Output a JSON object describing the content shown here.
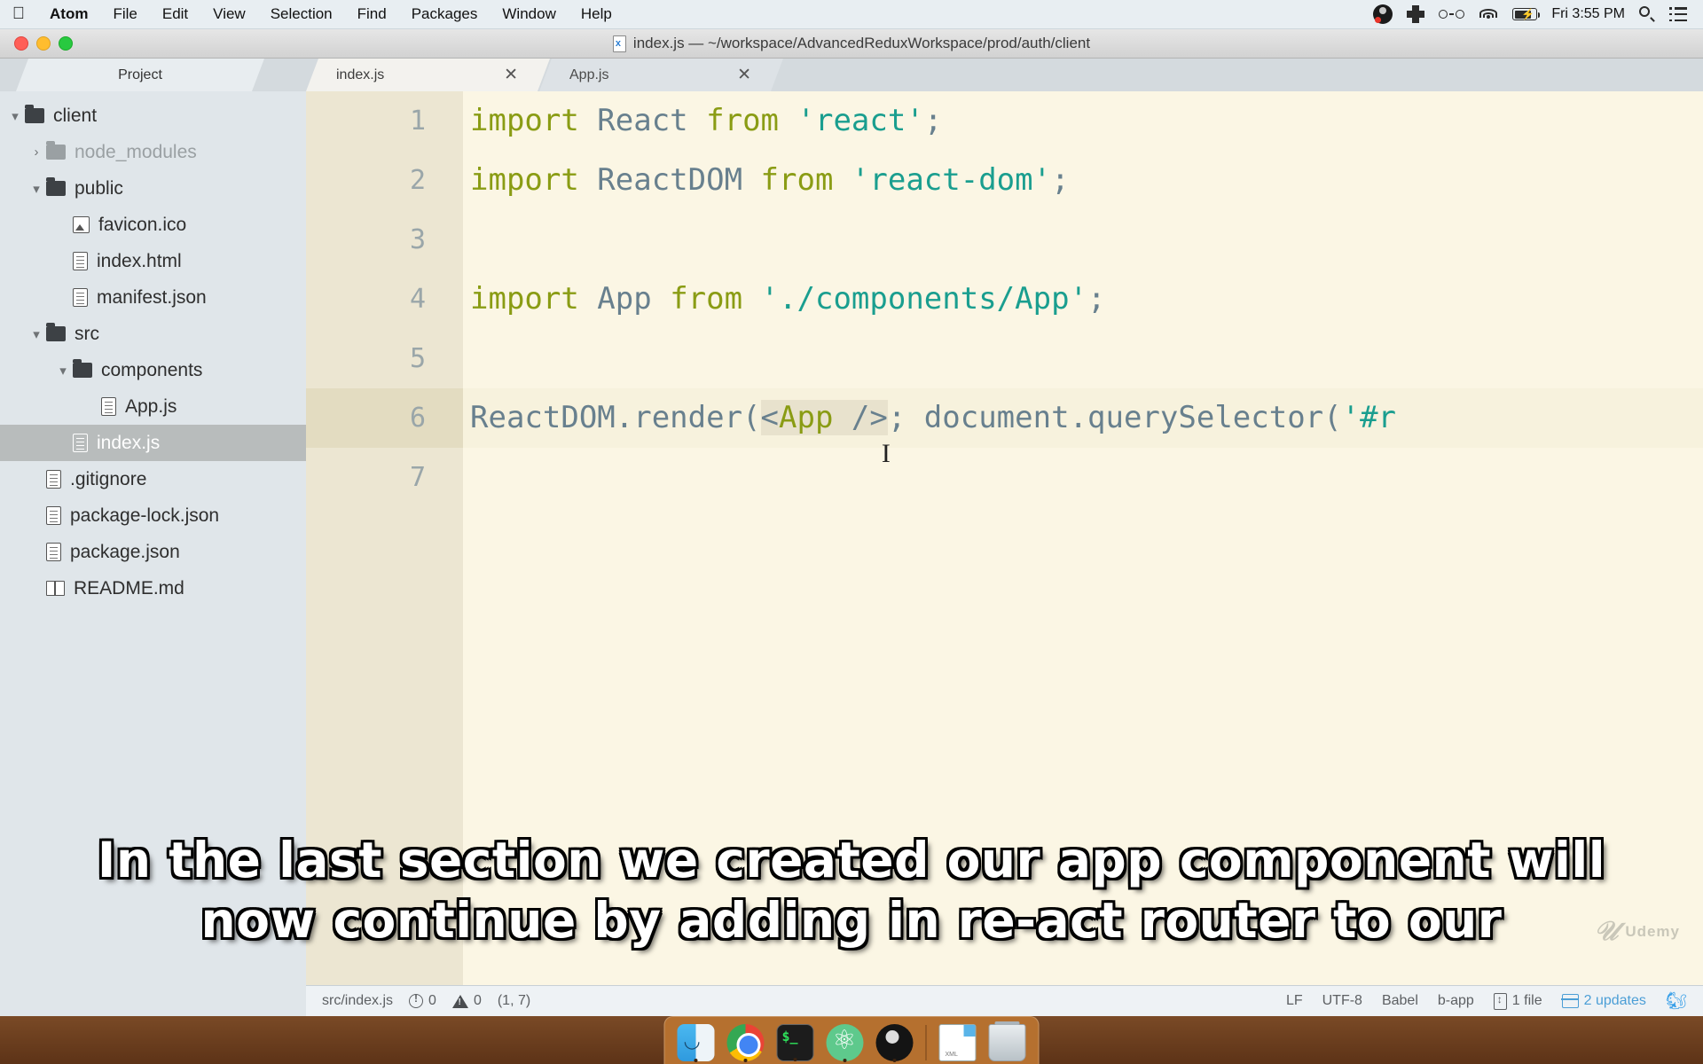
{
  "menubar": {
    "apple_icon": "apple-logo",
    "items": [
      "Atom",
      "File",
      "Edit",
      "View",
      "Selection",
      "Find",
      "Packages",
      "Window",
      "Help"
    ],
    "status_icons": [
      "obs-icon",
      "cross-icon",
      "glasses-icon",
      "wifi-icon",
      "battery-icon"
    ],
    "clock": "Fri 3:55 PM",
    "search_icon": "search-icon",
    "control_center_icon": "list-icon"
  },
  "window": {
    "title": "index.js — ~/workspace/AdvancedReduxWorkspace/prod/auth/client",
    "title_icon": "js-file-icon",
    "traffic_lights": [
      "close-button",
      "minimize-button",
      "zoom-button"
    ]
  },
  "treeview": {
    "tab_label": "Project",
    "items": [
      {
        "label": "client",
        "type": "folder",
        "indent": 0,
        "twisty": "▾",
        "selected": false,
        "muted": false
      },
      {
        "label": "node_modules",
        "type": "folder",
        "indent": 1,
        "twisty": "›",
        "selected": false,
        "muted": true
      },
      {
        "label": "public",
        "type": "folder",
        "indent": 1,
        "twisty": "▾",
        "selected": false,
        "muted": false
      },
      {
        "label": "favicon.ico",
        "type": "image",
        "indent": 2,
        "twisty": "",
        "selected": false,
        "muted": false
      },
      {
        "label": "index.html",
        "type": "file",
        "indent": 2,
        "twisty": "",
        "selected": false,
        "muted": false
      },
      {
        "label": "manifest.json",
        "type": "file",
        "indent": 2,
        "twisty": "",
        "selected": false,
        "muted": false
      },
      {
        "label": "src",
        "type": "folder",
        "indent": 1,
        "twisty": "▾",
        "selected": false,
        "muted": false
      },
      {
        "label": "components",
        "type": "folder",
        "indent": 2,
        "twisty": "▾",
        "selected": false,
        "muted": false
      },
      {
        "label": "App.js",
        "type": "file",
        "indent": 3,
        "twisty": "",
        "selected": false,
        "muted": false
      },
      {
        "label": "index.js",
        "type": "file",
        "indent": 2,
        "twisty": "",
        "selected": true,
        "muted": false
      },
      {
        "label": ".gitignore",
        "type": "file",
        "indent": 1,
        "twisty": "",
        "selected": false,
        "muted": false
      },
      {
        "label": "package-lock.json",
        "type": "file",
        "indent": 1,
        "twisty": "",
        "selected": false,
        "muted": false
      },
      {
        "label": "package.json",
        "type": "file",
        "indent": 1,
        "twisty": "",
        "selected": false,
        "muted": false
      },
      {
        "label": "README.md",
        "type": "book",
        "indent": 1,
        "twisty": "",
        "selected": false,
        "muted": false
      }
    ]
  },
  "editor": {
    "tabs": [
      {
        "label": "index.js",
        "active": true,
        "close": "✕"
      },
      {
        "label": "App.js",
        "active": false,
        "close": "✕"
      }
    ],
    "line_numbers": [
      "1",
      "2",
      "3",
      "4",
      "5",
      "6",
      "7"
    ],
    "active_line": 6,
    "lines": [
      {
        "n": 1,
        "tokens": [
          {
            "t": "import ",
            "c": "kw"
          },
          {
            "t": "React",
            "c": "id"
          },
          {
            "t": " ",
            "c": "id"
          },
          {
            "t": "from",
            "c": "kw"
          },
          {
            "t": " ",
            "c": "id"
          },
          {
            "t": "'react'",
            "c": "str"
          },
          {
            "t": ";",
            "c": "id"
          }
        ]
      },
      {
        "n": 2,
        "tokens": [
          {
            "t": "import ",
            "c": "kw"
          },
          {
            "t": "ReactDOM",
            "c": "id"
          },
          {
            "t": " ",
            "c": "id"
          },
          {
            "t": "from",
            "c": "kw"
          },
          {
            "t": " ",
            "c": "id"
          },
          {
            "t": "'react-dom'",
            "c": "str"
          },
          {
            "t": ";",
            "c": "id"
          }
        ]
      },
      {
        "n": 3,
        "tokens": []
      },
      {
        "n": 4,
        "tokens": [
          {
            "t": "import ",
            "c": "kw"
          },
          {
            "t": "App",
            "c": "id"
          },
          {
            "t": " ",
            "c": "id"
          },
          {
            "t": "from",
            "c": "kw"
          },
          {
            "t": " ",
            "c": "id"
          },
          {
            "t": "'./components/App'",
            "c": "str"
          },
          {
            "t": ";",
            "c": "id"
          }
        ]
      },
      {
        "n": 5,
        "tokens": []
      },
      {
        "n": 6,
        "tokens": [
          {
            "t": "ReactDOM.render(",
            "c": "id"
          },
          {
            "t": "<",
            "c": "id jsx-tagged"
          },
          {
            "t": "App",
            "c": "kw jsx-tagged"
          },
          {
            "t": " />",
            "c": "id jsx-tagged"
          },
          {
            "t": ";",
            "c": "id"
          },
          {
            "t": " document.querySelector(",
            "c": "id"
          },
          {
            "t": "'#r",
            "c": "str"
          }
        ]
      },
      {
        "n": 7,
        "tokens": []
      }
    ],
    "raw_text": "import React from 'react';\nimport ReactDOM from 'react-dom';\n\nimport App from './components/App';\n\nReactDOM.render(<App />, document.querySelector('#r\n"
  },
  "statusbar": {
    "file_path": "src/index.js",
    "error_icon": "error-icon",
    "error_count": "0",
    "warning_icon": "warning-icon",
    "warning_count": "0",
    "cursor_position": "(1, 7)",
    "line_ending": "LF",
    "encoding": "UTF-8",
    "grammar": "Babel",
    "branch": "b-app",
    "file_changes_icon": "file-changes-icon",
    "file_changes": "1 file",
    "updates_icon": "package-icon",
    "updates": "2 updates",
    "squirrel_icon": "squirrel-icon"
  },
  "caption": {
    "line1": "In the last section we created our app component will",
    "line2": "now continue by adding in re-act router to our"
  },
  "watermark": {
    "mark": "𝒰",
    "text": "Udemy"
  },
  "dock": {
    "items": [
      {
        "name": "finder",
        "running": true
      },
      {
        "name": "chrome",
        "running": true
      },
      {
        "name": "terminal",
        "running": true
      },
      {
        "name": "atom",
        "running": true
      },
      {
        "name": "obs",
        "running": true
      },
      {
        "name": "separator",
        "running": false
      },
      {
        "name": "xml-document",
        "running": false
      },
      {
        "name": "trash",
        "running": false
      }
    ]
  },
  "colors": {
    "menubar_bg": "#e8eef2",
    "editor_bg": "#fbf6e4",
    "gutter_bg": "#ece6d2",
    "active_line_gutter": "#e3dcc1",
    "treeview_bg": "#e0e6ea",
    "selection_bg": "#b8bcbc",
    "keyword": "#8a9c14",
    "identifier": "#68808e",
    "string": "#1a9e8f",
    "accent_blue": "#4b9ed6",
    "dock_bg": "#b5702f"
  }
}
